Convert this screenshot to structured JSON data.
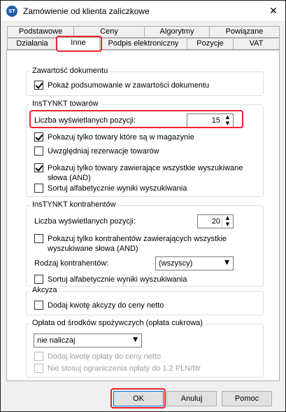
{
  "window": {
    "title": "Zamówienie od klienta zaliczkowe",
    "close_glyph": "✕",
    "app_icon_text": "ST"
  },
  "tabs": {
    "row1": [
      "Podstawowe",
      "Ceny",
      "Algorytmy",
      "Powiązane"
    ],
    "row2": [
      "Działania",
      "Inne",
      "Podpis elektroniczny",
      "Pozycje",
      "VAT"
    ],
    "active": "Inne"
  },
  "groups": {
    "doc_content": {
      "title": "Zawartość dokumentu",
      "show_summary": {
        "label": "Pokaż podsumowanie w zawartości dokumentu",
        "checked": true
      }
    },
    "instynkt_goods": {
      "title": "InsTYNKT towarów",
      "count_label": "Liczba wyświetlanych pozycji:",
      "count_value": "15",
      "options": [
        {
          "label": "Pokazuj tylko towary które są w magazynie",
          "checked": true
        },
        {
          "label": "Uwzględniaj rezerwacje towarów",
          "checked": false
        },
        {
          "label": "Pokazuj tylko towary zawierające wszystkie wyszukiwane",
          "label2": "słowa (AND)",
          "checked": true
        },
        {
          "label": "Sortuj alfabetycznie wyniki wyszukiwania",
          "checked": false
        }
      ]
    },
    "instynkt_contractors": {
      "title": "InsTYNKT kontrahentów",
      "count_label": "Liczba wyświetlanych pozycji:",
      "count_value": "20",
      "only_all_words": {
        "label": "Pokazuj tylko kontrahentów zawierających wszystkie",
        "label2": "wyszukiwane słowa (AND)",
        "checked": false
      },
      "type_label": "Rodzaj kontrahentów:",
      "type_value": "(wszyscy)",
      "sort": {
        "label": "Sortuj alfabetycznie wyniki wyszukiwania",
        "checked": false
      }
    },
    "excise": {
      "title": "Akcyza",
      "add_excise": {
        "label": "Dodaj kwotę akcyzy do ceny netto",
        "checked": false
      }
    },
    "sugar_fee": {
      "title": "Opłata od środków spożywczych (opłata cukrowa)",
      "select_value": "nie naliczaj",
      "add_fee": {
        "label": "Dodaj kwotę opłaty do ceny netto",
        "checked": false
      },
      "no_limit": {
        "label": "Nie stosuj ograniczenia opłaty do 1.2 PLN/litr",
        "checked": false
      }
    }
  },
  "buttons": {
    "ok": "OK",
    "cancel": "Anuluj",
    "help": "Pomoc"
  },
  "colors": {
    "highlight": "#e8242d",
    "tab_border": "#adadad",
    "group_border": "#d5dfe5"
  }
}
